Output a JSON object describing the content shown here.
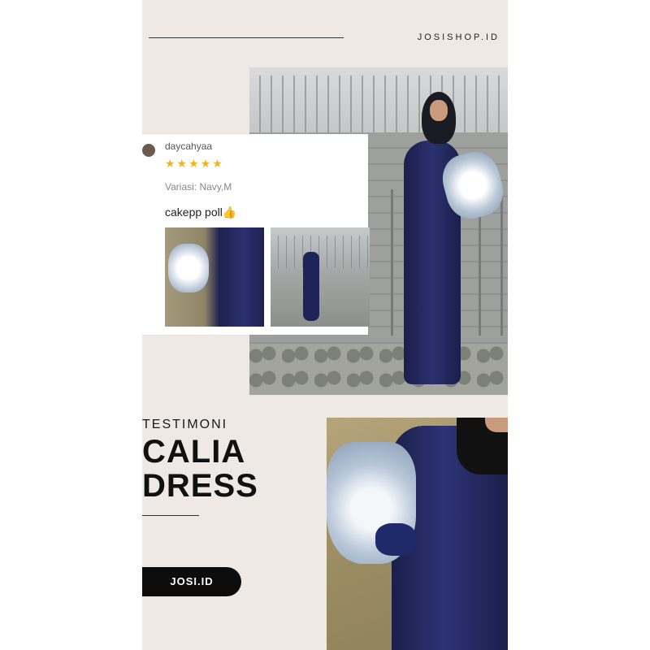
{
  "brand": "JOSISHOP.ID",
  "review": {
    "username": "daycahyaa",
    "stars": "★★★★★",
    "variant": "Variasi: Navy,M",
    "comment": "cakepp poll👍"
  },
  "headline": {
    "kicker": "TESTIMONI",
    "title": "CALIA\nDRESS"
  },
  "cta": {
    "label": "JOSI.ID"
  },
  "colors": {
    "background": "#efe9e6",
    "navy": "#2b3170",
    "star": "#f2b31b",
    "pill": "#0c0c0c"
  }
}
